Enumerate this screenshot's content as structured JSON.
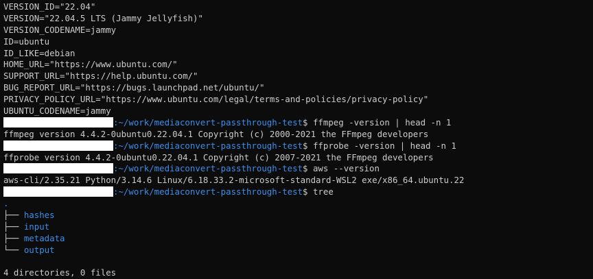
{
  "os_release": [
    "VERSION_ID=\"22.04\"",
    "VERSION=\"22.04.5 LTS (Jammy Jellyfish)\"",
    "VERSION_CODENAME=jammy",
    "ID=ubuntu",
    "ID_LIKE=debian",
    "HOME_URL=\"https://www.ubuntu.com/\"",
    "SUPPORT_URL=\"https://help.ubuntu.com/\"",
    "BUG_REPORT_URL=\"https://bugs.launchpad.net/ubuntu/\"",
    "PRIVACY_POLICY_URL=\"https://www.ubuntu.com/legal/terms-and-policies/privacy-policy\"",
    "UBUNTU_CODENAME=jammy"
  ],
  "prompt": {
    "path": ":~/work/mediaconvert-passthrough-test",
    "symbol": "$"
  },
  "sessions": [
    {
      "command": " ffmpeg -version | head -n 1",
      "output": "ffmpeg version 4.4.2-0ubuntu0.22.04.1 Copyright (c) 2000-2021 the FFmpeg developers"
    },
    {
      "command": " ffprobe -version | head -n 1",
      "output": "ffprobe version 4.4.2-0ubuntu0.22.04.1 Copyright (c) 2007-2021 the FFmpeg developers"
    },
    {
      "command": " aws --version",
      "output": "aws-cli/2.35.21 Python/3.14.6 Linux/6.18.33.2-microsoft-standard-WSL2 exe/x86_64.ubuntu.22"
    },
    {
      "command": " tree"
    }
  ],
  "tree": {
    "root": ".",
    "branch_mid": "├── ",
    "branch_last": "└── ",
    "entries": [
      "hashes",
      "input",
      "metadata",
      "output"
    ],
    "summary": "4 directories, 0 files"
  },
  "colors": {
    "background": "#0c0c0c",
    "foreground": "#cccccc",
    "path": "#3b8eea",
    "redaction": "#ffffff"
  }
}
